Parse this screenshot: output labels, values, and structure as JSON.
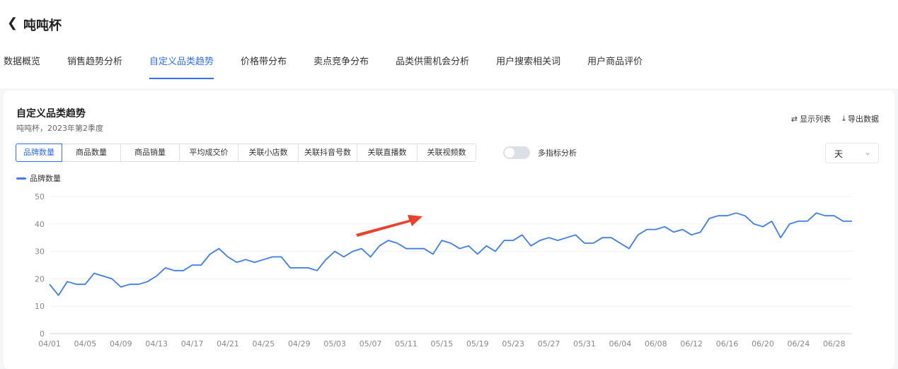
{
  "page": {
    "back_icon": "chevron-left-icon",
    "title": "吨吨杯"
  },
  "nav": {
    "tabs": [
      "数据概览",
      "销售趋势分析",
      "自定义品类趋势",
      "价格带分布",
      "卖点竞争分布",
      "品类供需机会分析",
      "用户搜索相关词",
      "用户商品评价"
    ],
    "active_index": 2
  },
  "card": {
    "title": "自定义品类趋势",
    "subtitle": "吨吨杯，2023年第2季度",
    "show_list_label": "显示列表",
    "export_label": "导出数据"
  },
  "metrics": {
    "tabs": [
      "品牌数量",
      "商品数量",
      "商品销量",
      "平均成交价",
      "关联小店数",
      "关联抖音号数",
      "关联直播数",
      "关联视频数"
    ],
    "active_index": 0
  },
  "multi_metric_label": "多指标分析",
  "granularity": "天",
  "colors": {
    "accent": "#2f6ff0",
    "line": "#3b7ded",
    "arrow": "#e8412c"
  },
  "chart_data": {
    "type": "line",
    "ylim": [
      0,
      50
    ],
    "yticks": [
      0,
      10,
      20,
      30,
      40,
      50
    ],
    "xtick_labels": [
      "04/01",
      "04/05",
      "04/09",
      "04/13",
      "04/17",
      "04/21",
      "04/25",
      "04/29",
      "05/03",
      "05/07",
      "05/11",
      "05/15",
      "05/19",
      "05/23",
      "05/27",
      "05/31",
      "06/04",
      "06/08",
      "06/12",
      "06/16",
      "06/20",
      "06/24",
      "06/28"
    ],
    "grid": true,
    "legend": "top-left",
    "series": [
      {
        "name": "品牌数量",
        "x_start": "04/01",
        "values": [
          18,
          14,
          19,
          18,
          18,
          22,
          21,
          20,
          17,
          18,
          18,
          19,
          21,
          24,
          23,
          23,
          25,
          25,
          29,
          31,
          28,
          26,
          27,
          26,
          27,
          28,
          28,
          24,
          24,
          24,
          23,
          27,
          30,
          28,
          30,
          31,
          28,
          32,
          34,
          33,
          31,
          31,
          31,
          29,
          34,
          33,
          31,
          32,
          29,
          32,
          30,
          34,
          34,
          36,
          32,
          34,
          35,
          34,
          35,
          36,
          33,
          33,
          35,
          35,
          33,
          31,
          36,
          38,
          38,
          39,
          37,
          38,
          36,
          37,
          42,
          43,
          43,
          44,
          43,
          40,
          39,
          41,
          35,
          40,
          41,
          41,
          44,
          43,
          43,
          41,
          41
        ]
      }
    ]
  }
}
